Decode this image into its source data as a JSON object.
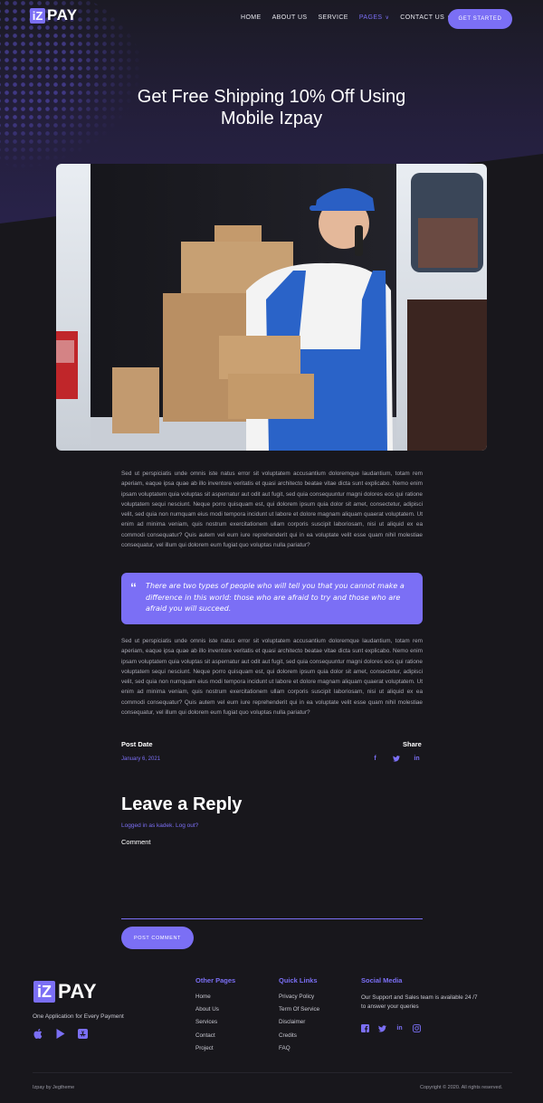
{
  "header": {
    "logo_mark": "iZ",
    "logo_text": "PAY",
    "nav": [
      {
        "label": "HOME"
      },
      {
        "label": "ABOUT US"
      },
      {
        "label": "SERVICE"
      },
      {
        "label": "PAGES"
      },
      {
        "label": "CONTACT US"
      }
    ],
    "cta_label": "GET STARTED"
  },
  "post": {
    "title_line1": "Get Free Shipping 10% Off Using",
    "title_line2": "Mobile Izpay",
    "paragraph1": "Sed ut perspiciatis unde omnis iste natus error sit voluptatem accusantium doloremque laudantium, totam rem aperiam, eaque ipsa quae ab illo inventore veritatis et quasi architecto beatae vitae dicta sunt explicabo. Nemo enim ipsam voluptatem quia voluptas sit aspernatur aut odit aut fugit, sed quia consequuntur magni dolores eos qui ratione voluptatem sequi nesciunt. Neque porro quisquam est, qui dolorem ipsum quia dolor sit amet, consectetur, adipisci velit, sed quia non numquam eius modi tempora incidunt ut labore et dolore magnam aliquam quaerat voluptatem. Ut enim ad minima veniam, quis nostrum exercitationem ullam corporis suscipit laboriosam, nisi ut aliquid ex ea commodi consequatur? Quis autem vel eum iure reprehenderit qui in ea voluptate velit esse quam nihil molestiae consequatur, vel illum qui dolorem eum fugiat quo voluptas nulla pariatur?",
    "quote": "There are two types of people who will tell you that you cannot make a difference in this world: those who are afraid to try and those who are afraid you will succeed.",
    "paragraph2": "Sed ut perspiciatis unde omnis iste natus error sit voluptatem accusantium doloremque laudantium, totam rem aperiam, eaque ipsa quae ab illo inventore veritatis et quasi architecto beatae vitae dicta sunt explicabo. Nemo enim ipsam voluptatem quia voluptas sit aspernatur aut odit aut fugit, sed quia consequuntur magni dolores eos qui ratione voluptatem sequi nesciunt. Neque porro quisquam est, qui dolorem ipsum quia dolor sit amet, consectetur, adipisci velit, sed quia non numquam eius modi tempora incidunt ut labore et dolore magnam aliquam quaerat voluptatem. Ut enim ad minima veniam, quis nostrum exercitationem ullam corporis suscipit laboriosam, nisi ut aliquid ex ea commodi consequatur? Quis autem vel eum iure reprehenderit qui in ea voluptate velit esse quam nihil molestiae consequatur, vel illum qui dolorem eum fugiat quo voluptas nulla pariatur?",
    "post_date_label": "Post Date",
    "post_date": "January 6, 2021",
    "share_label": "Share",
    "share_icons": [
      "facebook-icon",
      "twitter-icon",
      "linkedin-icon"
    ]
  },
  "reply": {
    "title": "Leave a Reply",
    "logged_in": "Logged in as kadek. Log out?",
    "comment_label": "Comment",
    "submit_label": "POST COMMENT"
  },
  "footer": {
    "logo_mark": "iZ",
    "logo_text": "PAY",
    "tagline": "One Application for Every Payment",
    "app_icons": [
      "apple-icon",
      "google-play-icon",
      "app-store-icon"
    ],
    "other_pages": {
      "title": "Other Pages",
      "items": [
        "Home",
        "About Us",
        "Services",
        "Contact",
        "Project"
      ]
    },
    "quick_links": {
      "title": "Quick Links",
      "items": [
        "Privacy Policy",
        "Term Of Service",
        "Disclaimer",
        "Credits",
        "FAQ"
      ]
    },
    "social": {
      "title": "Social Media",
      "text": "Our Support and Sales team is available 24 /7 to answer your queries",
      "icons": [
        "facebook-icon",
        "twitter-icon",
        "linkedin-icon",
        "instagram-icon"
      ]
    },
    "credit": "Izpay by Jegtheme",
    "copyright": "Copyright © 2020. All rights reserved."
  },
  "colors": {
    "accent": "#7b6ff5",
    "background": "#18171c"
  }
}
